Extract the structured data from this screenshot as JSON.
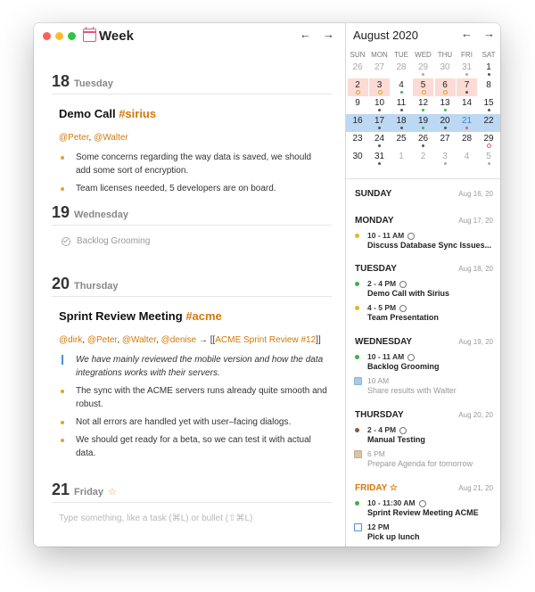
{
  "window": {
    "title": "Week",
    "nav_prev": "←",
    "nav_next": "→"
  },
  "week": [
    {
      "num": "18",
      "name": "Tuesday",
      "note_title": "Demo Call ",
      "note_tag": "#sirius",
      "mentions": [
        "@Peter",
        ", ",
        "@Walter"
      ],
      "bullets": [
        "Some concerns regarding the way data is saved, we should add some sort of encryption.",
        "Team licenses needed, 5 developers are on board."
      ]
    },
    {
      "num": "19",
      "name": "Wednesday",
      "task": "Backlog Grooming"
    },
    {
      "num": "20",
      "name": "Thursday",
      "note_title": "Sprint Review Meeting ",
      "note_tag": "#acme",
      "mentions_line": {
        "m1": "@dirk",
        "sep1": ", ",
        "m2": "@Peter",
        "sep2": ", ",
        "m3": "@Walter",
        "sep3": ", ",
        "m4": "@denise",
        "arrow": " → [[",
        "link": "ACME Sprint Review #12",
        "close": "]]"
      },
      "quote": "We have mainly reviewed the mobile version and how the data integrations works with their servers.",
      "bullets": [
        "The sync with the ACME servers runs already quite smooth and robust.",
        "Not all errors are handled yet with user–facing dialogs.",
        "We should get ready for a beta, so we can test it with actual data."
      ]
    },
    {
      "num": "21",
      "name": "Friday",
      "placeholder": "Type something, like a task (⌘L) or bullet (⇧⌘L)"
    }
  ],
  "calendar": {
    "month": "August 2020",
    "weekdays": [
      "SUN",
      "MON",
      "TUE",
      "WED",
      "THU",
      "FRI",
      "SAT"
    ],
    "weeks": [
      [
        "26",
        "27",
        "28",
        "29",
        "30",
        "31",
        "1"
      ],
      [
        "2",
        "3",
        "4",
        "5",
        "6",
        "7",
        "8"
      ],
      [
        "9",
        "10",
        "11",
        "12",
        "13",
        "14",
        "15"
      ],
      [
        "16",
        "17",
        "18",
        "19",
        "20",
        "21",
        "22"
      ],
      [
        "23",
        "24",
        "25",
        "26",
        "27",
        "28",
        "29"
      ],
      [
        "30",
        "31",
        "1",
        "2",
        "3",
        "4",
        "5"
      ]
    ]
  },
  "agenda": {
    "sunday": {
      "name": "SUNDAY",
      "date": "Aug 16, 20"
    },
    "monday": {
      "name": "MONDAY",
      "date": "Aug 17, 20",
      "events": [
        {
          "time": "10 - 11 AM",
          "title": "Discuss Database Sync Issues..."
        }
      ]
    },
    "tuesday": {
      "name": "TUESDAY",
      "date": "Aug 18, 20",
      "events": [
        {
          "time": "2 - 4 PM",
          "title": "Demo Call with Sirius"
        },
        {
          "time": "4 - 5 PM",
          "title": "Team Presentation"
        }
      ]
    },
    "wednesday": {
      "name": "WEDNESDAY",
      "date": "Aug 19, 20",
      "events": [
        {
          "time": "10 - 11 AM",
          "title": "Backlog Grooming"
        },
        {
          "time": "10 AM",
          "title": "Share results with Walter"
        }
      ]
    },
    "thursday": {
      "name": "THURSDAY",
      "date": "Aug 20, 20",
      "events": [
        {
          "time": "2 - 4 PM",
          "title": "Manual Testing"
        },
        {
          "time": "6 PM",
          "title": "Prepare Agenda for tomorrow"
        }
      ]
    },
    "friday": {
      "name": "FRIDAY",
      "date": "Aug 21, 20",
      "events": [
        {
          "time": "10 - 11:30 AM",
          "title": "Sprint Review Meeting ACME"
        },
        {
          "time": "12 PM",
          "title": "Pick up lunch"
        }
      ]
    }
  },
  "colors": {
    "accent_orange": "#d4790a",
    "bullet_yellow": "#e0a526",
    "event_green": "#3fb24a",
    "event_yellow": "#e8b820",
    "event_brown": "#8a5a3c",
    "selected_week": "#bcd8f2",
    "highlight_day": "#fcdad5",
    "today_blue": "#2e84e6"
  }
}
